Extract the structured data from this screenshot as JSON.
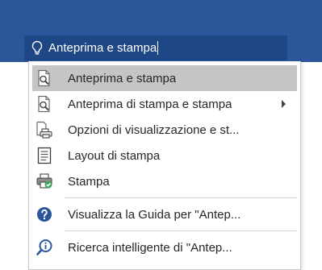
{
  "search": {
    "query": "Anteprima e stampa"
  },
  "menu": {
    "items": [
      {
        "label": "Anteprima e stampa",
        "icon": "print-preview-icon",
        "selected": true
      },
      {
        "label": "Anteprima di stampa e stampa",
        "icon": "print-preview-icon",
        "submenu": true
      },
      {
        "label": "Opzioni di visualizzazione e st...",
        "icon": "print-options-icon"
      },
      {
        "label": "Layout di stampa",
        "icon": "print-layout-icon"
      },
      {
        "label": "Stampa",
        "icon": "printer-icon"
      },
      {
        "label": "Visualizza la Guida per \"Antep...",
        "icon": "help-icon"
      },
      {
        "label": "Ricerca intelligente di \"Antep...",
        "icon": "smart-lookup-icon"
      }
    ]
  },
  "colors": {
    "ribbon": "#2b579a",
    "search_bar": "#1e4785",
    "selected_item": "#c5c5c5",
    "help_icon": "#2b579a"
  }
}
